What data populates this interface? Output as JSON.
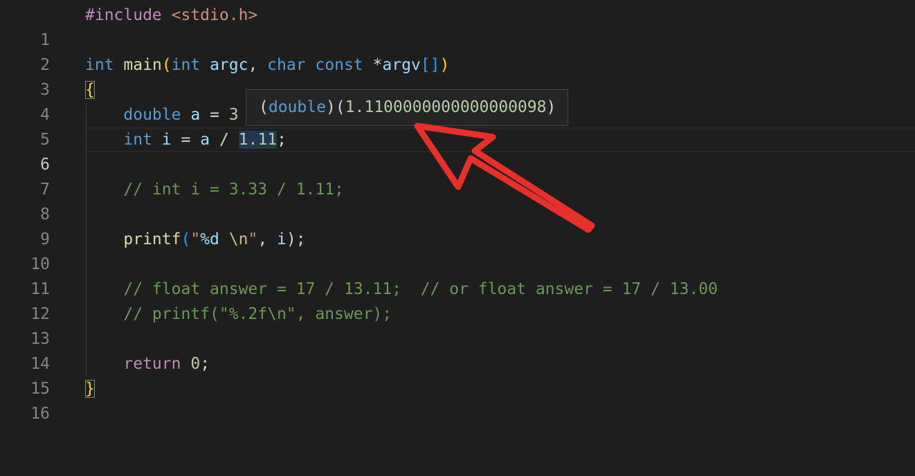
{
  "editor": {
    "active_line": 6,
    "line_numbers": [
      "1",
      "2",
      "3",
      "4",
      "5",
      "6",
      "7",
      "8",
      "9",
      "10",
      "11",
      "12",
      "13",
      "14",
      "15",
      "16"
    ],
    "code": {
      "l1_directive": "#include",
      "l1_header": "<stdio.h>",
      "l3_kw_int": "int",
      "l3_fn_main": "main",
      "l3_paren_open": "(",
      "l3_kw_int2": "int",
      "l3_param_argc": "argc",
      "l3_comma": ",",
      "l3_kw_char": "char",
      "l3_kw_const": "const",
      "l3_ptr": "*",
      "l3_param_argv": "argv",
      "l3_brackets": "[]",
      "l3_paren_close": ")",
      "l4_brace_open": "{",
      "l5_kw_double": "double",
      "l5_var_a": "a",
      "l5_assign": "=",
      "l5_value": "3",
      "l6_kw_int": "int",
      "l6_var_i": "i",
      "l6_assign": "=",
      "l6_var_a": "a",
      "l6_div": "/",
      "l6_num": "1.11",
      "l6_semi": ";",
      "l8_comment": "// int i = 3.33 / 1.11;",
      "l10_fn_printf": "printf",
      "l10_paren_open": "(",
      "l10_str_open": "\"",
      "l10_fmt": "%d",
      "l10_str_mid": " ",
      "l10_esc": "\\n",
      "l10_str_close": "\"",
      "l10_comma": ",",
      "l10_var_i": "i",
      "l10_end": ");",
      "l12_comment": "// float answer = 17 / 13.11;  // or float answer = 17 / 13.00",
      "l13_comment": "// printf(\"%.2f\\n\", answer);",
      "l15_kw_return": "return",
      "l15_num": "0",
      "l15_semi": ";",
      "l16_brace_close": "}"
    }
  },
  "hover": {
    "paren_open": "(",
    "type": "double",
    "paren_close": ")",
    "value_open": "(",
    "value": "1.1100000000000000098",
    "value_close": ")"
  },
  "colors": {
    "background": "#1e1e1e",
    "keyword": "#569cd6",
    "control": "#c586c0",
    "function": "#dcdcaa",
    "variable": "#9cdcfe",
    "number": "#b5cea8",
    "string": "#ce9178",
    "comment": "#6a9955",
    "annotation_arrow": "#e8302a"
  }
}
